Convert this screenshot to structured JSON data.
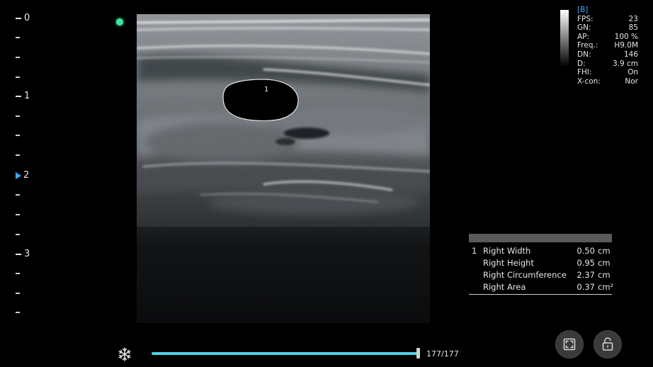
{
  "ruler": {
    "majors": [
      {
        "label": "0",
        "depth": 0
      },
      {
        "label": "1",
        "depth": 1
      },
      {
        "label": "2",
        "depth": 2
      },
      {
        "label": "3",
        "depth": 3
      }
    ],
    "focus_depth_label": "2",
    "accent_color": "#3ea6ff"
  },
  "status_dot_color": "#3fe6a3",
  "params": {
    "mode": "[B]",
    "rows": [
      {
        "label": "FPS:",
        "value": "23"
      },
      {
        "label": "GN:",
        "value": "85"
      },
      {
        "label": "AP:",
        "value": "100 %"
      },
      {
        "label": "Freq.:",
        "value": "H9.0M"
      },
      {
        "label": "DN:",
        "value": "146"
      },
      {
        "label": "D:",
        "value": "3.9 cm"
      },
      {
        "label": "FHI:",
        "value": "On"
      },
      {
        "label": "X-con:",
        "value": "Nor"
      }
    ]
  },
  "image": {
    "roi_label": "1"
  },
  "measurements": {
    "index": "1",
    "rows": [
      {
        "label": "Right Width",
        "value": "0.50",
        "unit": "cm"
      },
      {
        "label": "Right Height",
        "value": "0.95",
        "unit": "cm"
      },
      {
        "label": "Right Circumference",
        "value": "2.37",
        "unit": "cm"
      },
      {
        "label": "Right Area",
        "value": "0.37",
        "unit": "cm²"
      }
    ]
  },
  "cine": {
    "counter": "177/177",
    "progress": 1.0,
    "track_color": "#4fd2e4"
  },
  "controls": {
    "fullscreen_icon": "fullscreen-icon",
    "unlock_icon": "unlock-icon",
    "freeze_icon": "snowflake-icon"
  }
}
